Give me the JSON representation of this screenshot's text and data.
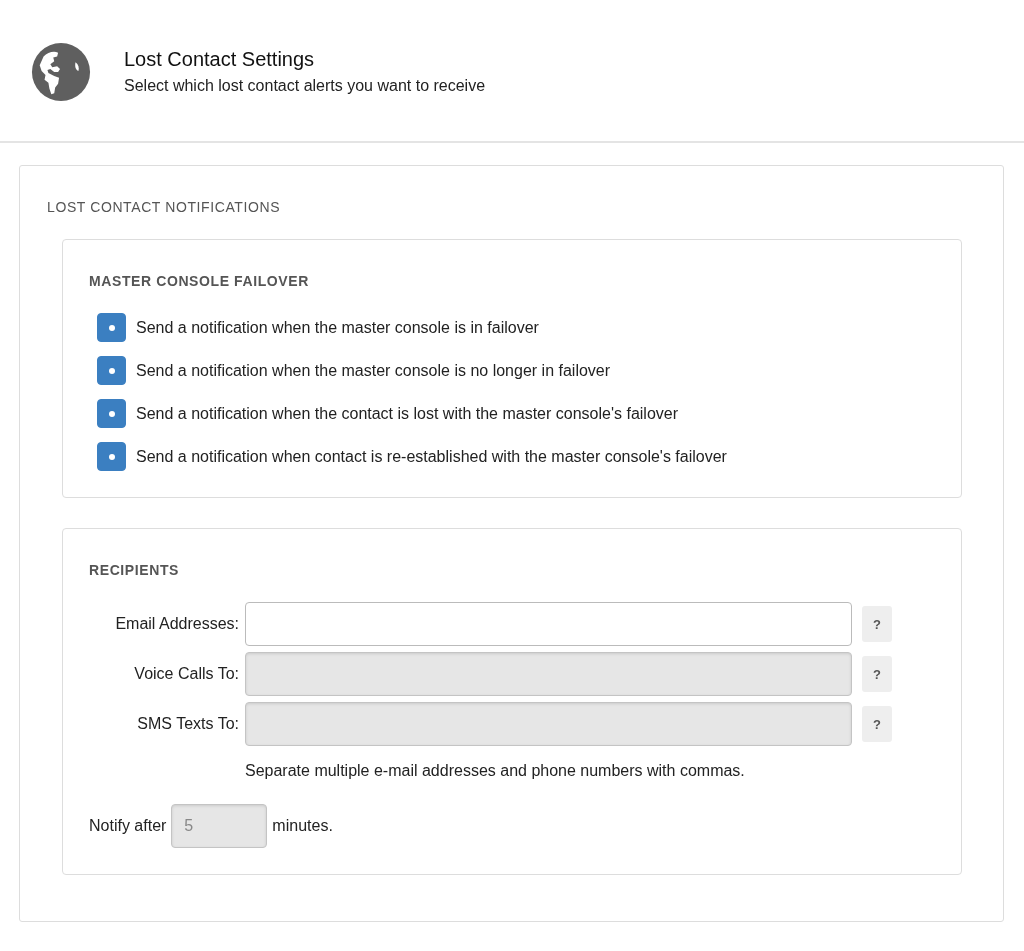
{
  "header": {
    "title": "Lost Contact Settings",
    "subtitle": "Select which lost contact alerts you want to receive"
  },
  "section_title": "LOST CONTACT NOTIFICATIONS",
  "failover": {
    "title": "MASTER CONSOLE FAILOVER",
    "options": [
      {
        "label": "Send a notification when the master console is in failover",
        "checked": true
      },
      {
        "label": "Send a notification when the master console is no longer in failover",
        "checked": true
      },
      {
        "label": "Send a notification when the contact is lost with the master console's failover",
        "checked": true
      },
      {
        "label": "Send a notification when contact is re-established with the master console's failover",
        "checked": true
      }
    ]
  },
  "recipients": {
    "title": "RECIPIENTS",
    "fields": [
      {
        "label": "Email Addresses:",
        "disabled": false,
        "help": "?"
      },
      {
        "label": "Voice Calls To:",
        "disabled": true,
        "help": "?"
      },
      {
        "label": "SMS Texts To:",
        "disabled": true,
        "help": "?"
      }
    ],
    "hint": "Separate multiple e-mail addresses and phone numbers with commas.",
    "notify": {
      "prefix": "Notify after",
      "value": "5",
      "disabled": true,
      "suffix": "minutes."
    }
  }
}
